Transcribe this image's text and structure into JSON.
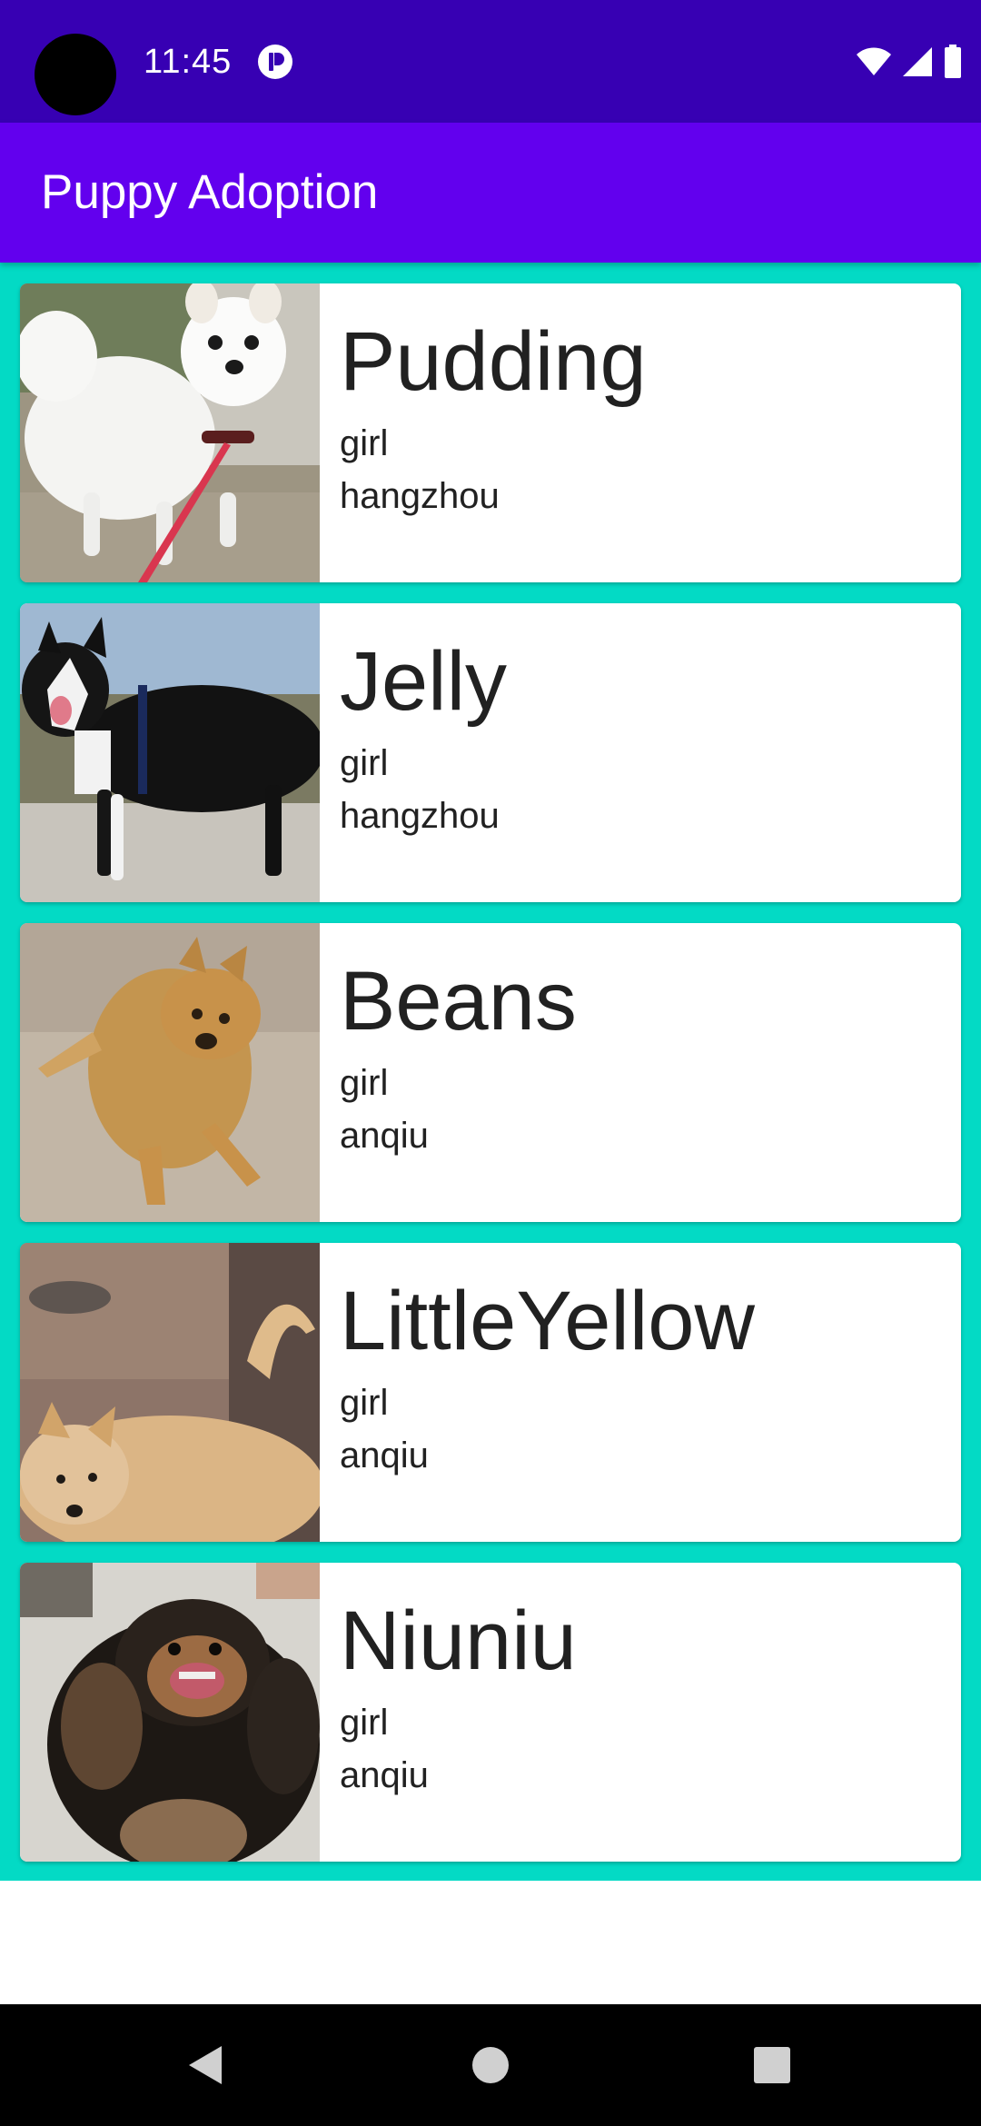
{
  "status_bar": {
    "time": "11:45",
    "icons": [
      "app-notification-icon",
      "wifi-icon",
      "signal-icon",
      "battery-icon"
    ]
  },
  "app_bar": {
    "title": "Puppy Adoption"
  },
  "colors": {
    "status_bar": "#3700b3",
    "app_bar": "#6200ee",
    "list_background": "#03dac5",
    "card": "#ffffff",
    "text": "#212121"
  },
  "puppies": [
    {
      "name": "Pudding",
      "gender": "girl",
      "city": "hangzhou",
      "photo": "white-fluffy-dog-photo"
    },
    {
      "name": "Jelly",
      "gender": "girl",
      "city": "hangzhou",
      "photo": "black-white-border-collie-photo"
    },
    {
      "name": "Beans",
      "gender": "girl",
      "city": "anqiu",
      "photo": "tan-dog-lying-photo"
    },
    {
      "name": "LittleYellow",
      "gender": "girl",
      "city": "anqiu",
      "photo": "yellow-dog-standing-photo"
    },
    {
      "name": "Niuniu",
      "gender": "girl",
      "city": "anqiu",
      "photo": "black-tan-long-haired-dog-photo"
    }
  ],
  "nav_bar": {
    "buttons": [
      "back-icon",
      "home-icon",
      "recents-icon"
    ]
  }
}
